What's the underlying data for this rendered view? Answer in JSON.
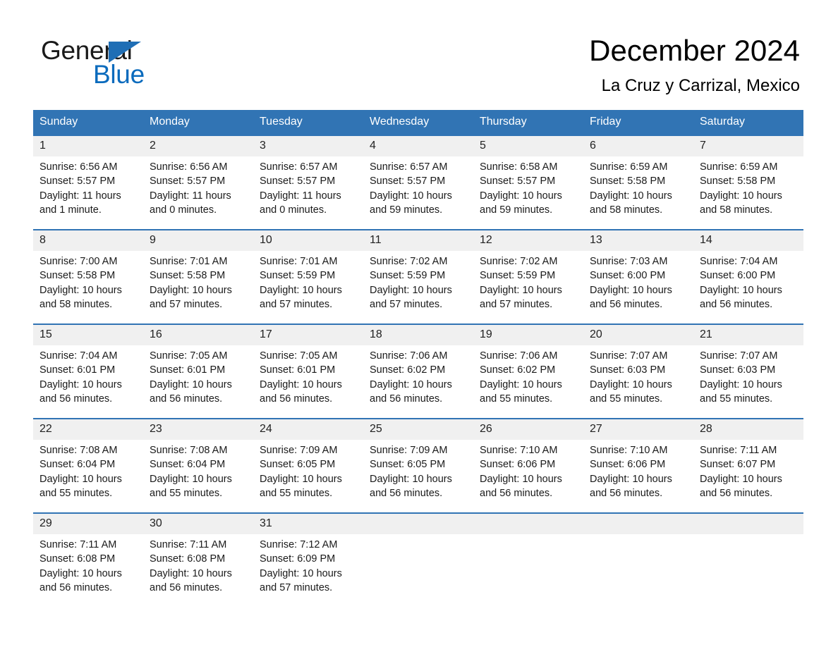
{
  "brand": {
    "word1": "General",
    "word2": "Blue",
    "triangle_color": "#1f6eb5",
    "blue_color": "#0b6bbd"
  },
  "header": {
    "title": "December 2024",
    "subtitle": "La Cruz y Carrizal, Mexico",
    "accent_color": "#3174b4",
    "band_color": "#f0f0f0"
  },
  "calendar": {
    "weekday_headers": [
      "Sunday",
      "Monday",
      "Tuesday",
      "Wednesday",
      "Thursday",
      "Friday",
      "Saturday"
    ],
    "weeks": [
      [
        {
          "day": "1",
          "sunrise": "Sunrise: 6:56 AM",
          "sunset": "Sunset: 5:57 PM",
          "daylight_line1": "Daylight: 11 hours",
          "daylight_line2": "and 1 minute."
        },
        {
          "day": "2",
          "sunrise": "Sunrise: 6:56 AM",
          "sunset": "Sunset: 5:57 PM",
          "daylight_line1": "Daylight: 11 hours",
          "daylight_line2": "and 0 minutes."
        },
        {
          "day": "3",
          "sunrise": "Sunrise: 6:57 AM",
          "sunset": "Sunset: 5:57 PM",
          "daylight_line1": "Daylight: 11 hours",
          "daylight_line2": "and 0 minutes."
        },
        {
          "day": "4",
          "sunrise": "Sunrise: 6:57 AM",
          "sunset": "Sunset: 5:57 PM",
          "daylight_line1": "Daylight: 10 hours",
          "daylight_line2": "and 59 minutes."
        },
        {
          "day": "5",
          "sunrise": "Sunrise: 6:58 AM",
          "sunset": "Sunset: 5:57 PM",
          "daylight_line1": "Daylight: 10 hours",
          "daylight_line2": "and 59 minutes."
        },
        {
          "day": "6",
          "sunrise": "Sunrise: 6:59 AM",
          "sunset": "Sunset: 5:58 PM",
          "daylight_line1": "Daylight: 10 hours",
          "daylight_line2": "and 58 minutes."
        },
        {
          "day": "7",
          "sunrise": "Sunrise: 6:59 AM",
          "sunset": "Sunset: 5:58 PM",
          "daylight_line1": "Daylight: 10 hours",
          "daylight_line2": "and 58 minutes."
        }
      ],
      [
        {
          "day": "8",
          "sunrise": "Sunrise: 7:00 AM",
          "sunset": "Sunset: 5:58 PM",
          "daylight_line1": "Daylight: 10 hours",
          "daylight_line2": "and 58 minutes."
        },
        {
          "day": "9",
          "sunrise": "Sunrise: 7:01 AM",
          "sunset": "Sunset: 5:58 PM",
          "daylight_line1": "Daylight: 10 hours",
          "daylight_line2": "and 57 minutes."
        },
        {
          "day": "10",
          "sunrise": "Sunrise: 7:01 AM",
          "sunset": "Sunset: 5:59 PM",
          "daylight_line1": "Daylight: 10 hours",
          "daylight_line2": "and 57 minutes."
        },
        {
          "day": "11",
          "sunrise": "Sunrise: 7:02 AM",
          "sunset": "Sunset: 5:59 PM",
          "daylight_line1": "Daylight: 10 hours",
          "daylight_line2": "and 57 minutes."
        },
        {
          "day": "12",
          "sunrise": "Sunrise: 7:02 AM",
          "sunset": "Sunset: 5:59 PM",
          "daylight_line1": "Daylight: 10 hours",
          "daylight_line2": "and 57 minutes."
        },
        {
          "day": "13",
          "sunrise": "Sunrise: 7:03 AM",
          "sunset": "Sunset: 6:00 PM",
          "daylight_line1": "Daylight: 10 hours",
          "daylight_line2": "and 56 minutes."
        },
        {
          "day": "14",
          "sunrise": "Sunrise: 7:04 AM",
          "sunset": "Sunset: 6:00 PM",
          "daylight_line1": "Daylight: 10 hours",
          "daylight_line2": "and 56 minutes."
        }
      ],
      [
        {
          "day": "15",
          "sunrise": "Sunrise: 7:04 AM",
          "sunset": "Sunset: 6:01 PM",
          "daylight_line1": "Daylight: 10 hours",
          "daylight_line2": "and 56 minutes."
        },
        {
          "day": "16",
          "sunrise": "Sunrise: 7:05 AM",
          "sunset": "Sunset: 6:01 PM",
          "daylight_line1": "Daylight: 10 hours",
          "daylight_line2": "and 56 minutes."
        },
        {
          "day": "17",
          "sunrise": "Sunrise: 7:05 AM",
          "sunset": "Sunset: 6:01 PM",
          "daylight_line1": "Daylight: 10 hours",
          "daylight_line2": "and 56 minutes."
        },
        {
          "day": "18",
          "sunrise": "Sunrise: 7:06 AM",
          "sunset": "Sunset: 6:02 PM",
          "daylight_line1": "Daylight: 10 hours",
          "daylight_line2": "and 56 minutes."
        },
        {
          "day": "19",
          "sunrise": "Sunrise: 7:06 AM",
          "sunset": "Sunset: 6:02 PM",
          "daylight_line1": "Daylight: 10 hours",
          "daylight_line2": "and 55 minutes."
        },
        {
          "day": "20",
          "sunrise": "Sunrise: 7:07 AM",
          "sunset": "Sunset: 6:03 PM",
          "daylight_line1": "Daylight: 10 hours",
          "daylight_line2": "and 55 minutes."
        },
        {
          "day": "21",
          "sunrise": "Sunrise: 7:07 AM",
          "sunset": "Sunset: 6:03 PM",
          "daylight_line1": "Daylight: 10 hours",
          "daylight_line2": "and 55 minutes."
        }
      ],
      [
        {
          "day": "22",
          "sunrise": "Sunrise: 7:08 AM",
          "sunset": "Sunset: 6:04 PM",
          "daylight_line1": "Daylight: 10 hours",
          "daylight_line2": "and 55 minutes."
        },
        {
          "day": "23",
          "sunrise": "Sunrise: 7:08 AM",
          "sunset": "Sunset: 6:04 PM",
          "daylight_line1": "Daylight: 10 hours",
          "daylight_line2": "and 55 minutes."
        },
        {
          "day": "24",
          "sunrise": "Sunrise: 7:09 AM",
          "sunset": "Sunset: 6:05 PM",
          "daylight_line1": "Daylight: 10 hours",
          "daylight_line2": "and 55 minutes."
        },
        {
          "day": "25",
          "sunrise": "Sunrise: 7:09 AM",
          "sunset": "Sunset: 6:05 PM",
          "daylight_line1": "Daylight: 10 hours",
          "daylight_line2": "and 56 minutes."
        },
        {
          "day": "26",
          "sunrise": "Sunrise: 7:10 AM",
          "sunset": "Sunset: 6:06 PM",
          "daylight_line1": "Daylight: 10 hours",
          "daylight_line2": "and 56 minutes."
        },
        {
          "day": "27",
          "sunrise": "Sunrise: 7:10 AM",
          "sunset": "Sunset: 6:06 PM",
          "daylight_line1": "Daylight: 10 hours",
          "daylight_line2": "and 56 minutes."
        },
        {
          "day": "28",
          "sunrise": "Sunrise: 7:11 AM",
          "sunset": "Sunset: 6:07 PM",
          "daylight_line1": "Daylight: 10 hours",
          "daylight_line2": "and 56 minutes."
        }
      ],
      [
        {
          "day": "29",
          "sunrise": "Sunrise: 7:11 AM",
          "sunset": "Sunset: 6:08 PM",
          "daylight_line1": "Daylight: 10 hours",
          "daylight_line2": "and 56 minutes."
        },
        {
          "day": "30",
          "sunrise": "Sunrise: 7:11 AM",
          "sunset": "Sunset: 6:08 PM",
          "daylight_line1": "Daylight: 10 hours",
          "daylight_line2": "and 56 minutes."
        },
        {
          "day": "31",
          "sunrise": "Sunrise: 7:12 AM",
          "sunset": "Sunset: 6:09 PM",
          "daylight_line1": "Daylight: 10 hours",
          "daylight_line2": "and 57 minutes."
        },
        {
          "day": "",
          "sunrise": "",
          "sunset": "",
          "daylight_line1": "",
          "daylight_line2": ""
        },
        {
          "day": "",
          "sunrise": "",
          "sunset": "",
          "daylight_line1": "",
          "daylight_line2": ""
        },
        {
          "day": "",
          "sunrise": "",
          "sunset": "",
          "daylight_line1": "",
          "daylight_line2": ""
        },
        {
          "day": "",
          "sunrise": "",
          "sunset": "",
          "daylight_line1": "",
          "daylight_line2": ""
        }
      ]
    ]
  }
}
